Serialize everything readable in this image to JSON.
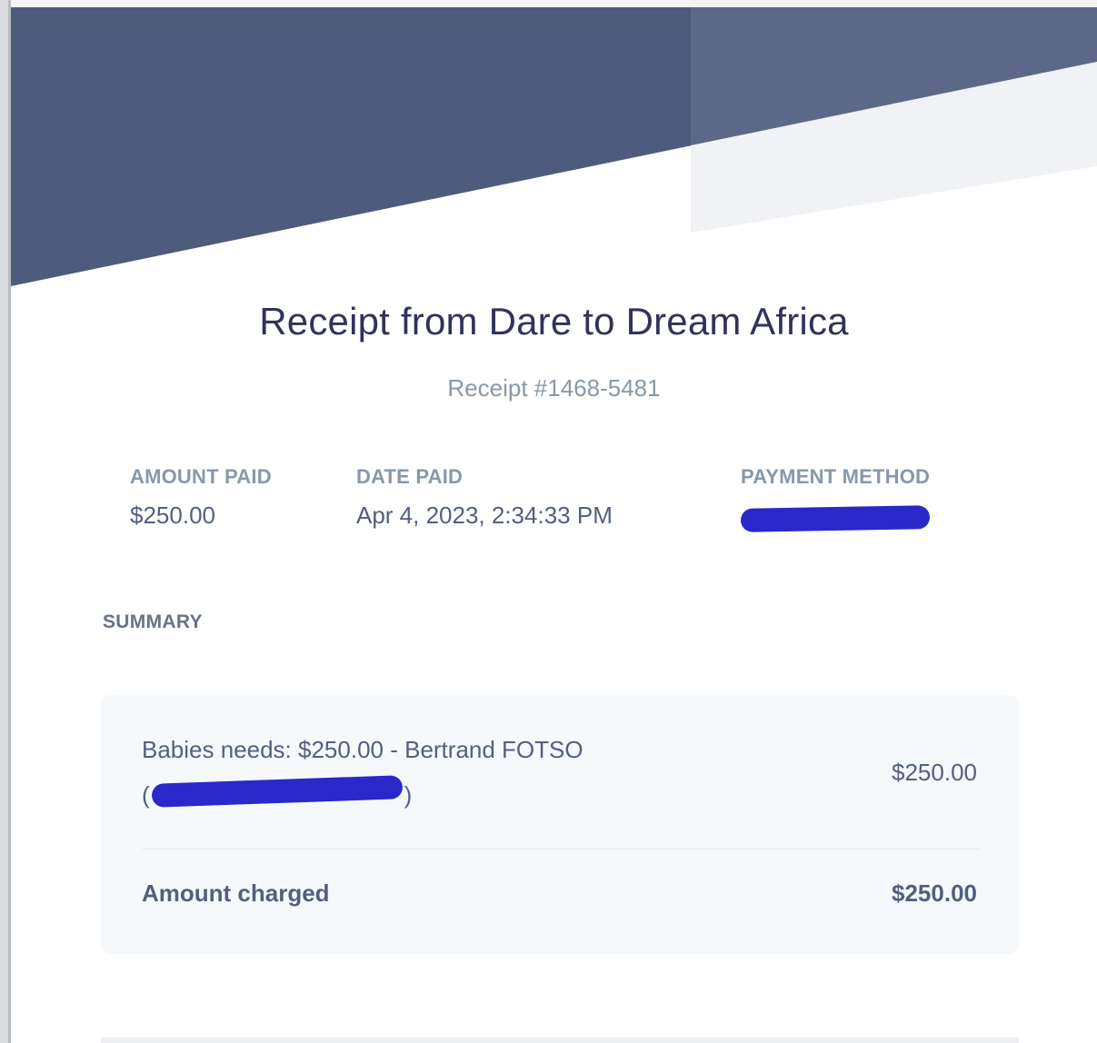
{
  "colors": {
    "header_band": "#4f5b7c",
    "title_text": "#32325d",
    "muted_text": "#8898aa",
    "body_text": "#525f7f",
    "card_background": "#f6f9fc",
    "redaction_marker": "#2a28c9"
  },
  "header": {
    "title": "Receipt from Dare to Dream Africa",
    "receipt_number": "Receipt #1468-5481"
  },
  "meta": {
    "amount_paid": {
      "label": "AMOUNT PAID",
      "value": "$250.00"
    },
    "date_paid": {
      "label": "DATE PAID",
      "value": "Apr 4, 2023, 2:34:33 PM"
    },
    "payment_method": {
      "label": "PAYMENT METHOD"
    }
  },
  "summary": {
    "heading": "SUMMARY",
    "item": {
      "description": "Babies needs: $250.00 - Bertrand FOTSO",
      "email_open": "(",
      "email_close": ")",
      "price": "$250.00"
    },
    "total": {
      "label": "Amount charged",
      "value": "$250.00"
    }
  }
}
